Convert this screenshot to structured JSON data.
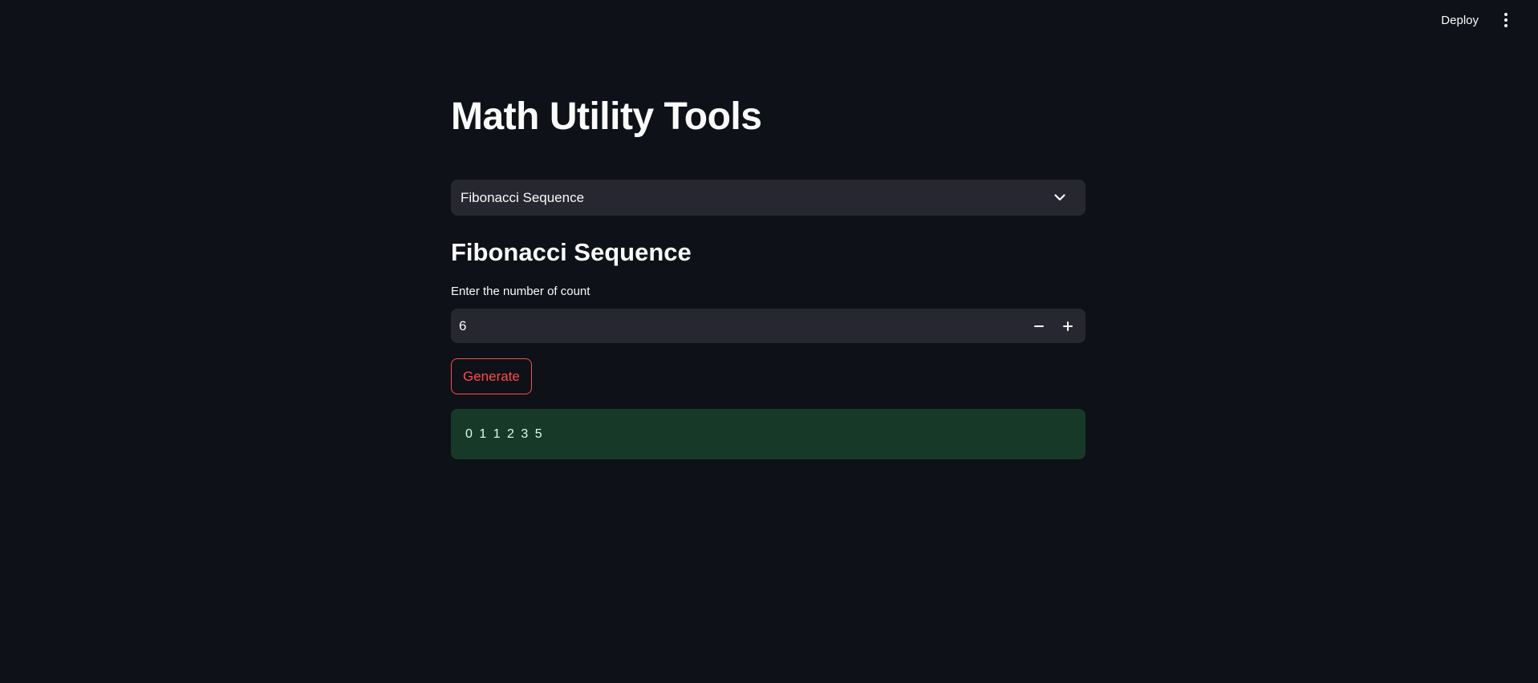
{
  "header": {
    "deploy_label": "Deploy",
    "menu_icon": "kebab-menu-icon"
  },
  "main": {
    "title": "Math Utility Tools",
    "tool_select": {
      "selected": "Fibonacci Sequence"
    },
    "section_heading": "Fibonacci Sequence",
    "count_input": {
      "label": "Enter the number of count",
      "value": "6",
      "decrement_symbol": "−",
      "increment_symbol": "+"
    },
    "generate_label": "Generate",
    "result": "0 1 1 2 3 5"
  },
  "colors": {
    "background": "#0e1117",
    "surface": "#262730",
    "accent": "#ff4b4b",
    "success_bg": "#173928",
    "text": "#fafafa"
  }
}
